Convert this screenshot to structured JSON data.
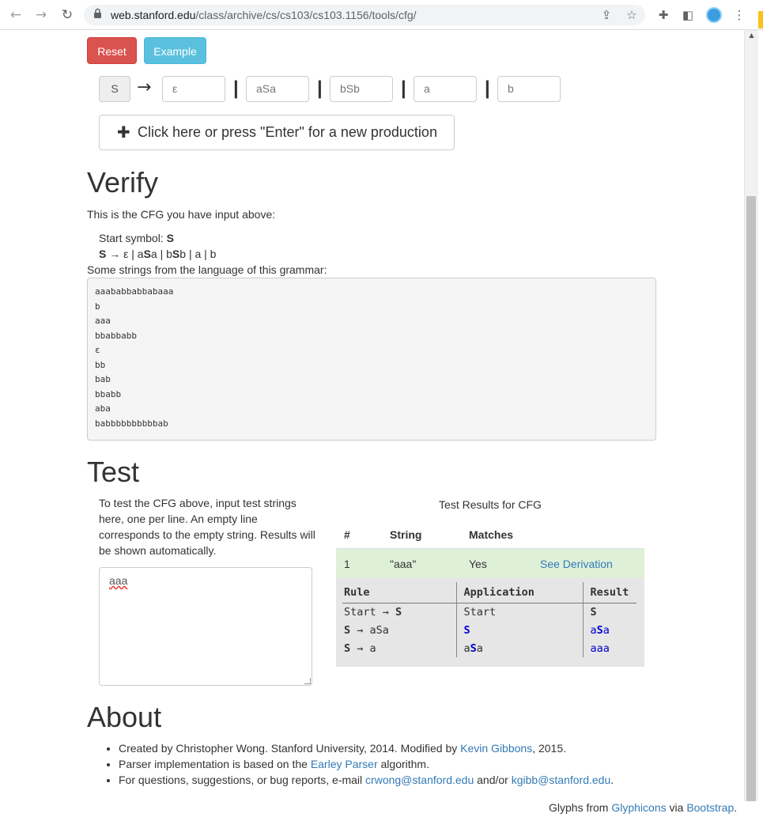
{
  "browser": {
    "url_host": "web.stanford.edu",
    "url_path": "/class/archive/cs/cs103/cs103.1156/tools/cfg/"
  },
  "toolbar": {
    "reset_label": "Reset",
    "example_label": "Example"
  },
  "production": {
    "start": "S",
    "arrow": "→",
    "separator": "|",
    "alternatives": [
      "ε",
      "aSa",
      "bSb",
      "a",
      "b"
    ]
  },
  "new_production_label": "Click here or press \"Enter\" for a new production",
  "verify": {
    "heading": "Verify",
    "intro": "This is the CFG you have input above:",
    "start_label": "Start symbol: ",
    "start_value": "S",
    "rule_lhs": "S",
    "rule_arrow": " → ε | a",
    "rule_s1": "S",
    "rule_mid": "a | b",
    "rule_s2": "S",
    "rule_tail": "b | a | b",
    "strings_label": "Some strings from the language of this grammar:",
    "strings": [
      "aaababbabbabaaa",
      "b",
      "aaa",
      "bbabbabb",
      "ε",
      "bb",
      "bab",
      "bbabb",
      "aba",
      "babbbbbbbbbbab"
    ]
  },
  "test": {
    "heading": "Test",
    "help": "To test the CFG above, input test strings here, one per line. An empty line corresponds to the empty string. Results will be shown automatically.",
    "input_value": "aaa",
    "results_caption": "Test Results for CFG",
    "columns": [
      "#",
      "String",
      "Matches"
    ],
    "row": {
      "num": "1",
      "string": "\"aaa\"",
      "matches": "Yes",
      "link": "See Derivation"
    },
    "derivation": {
      "headers": [
        "Rule",
        "Application",
        "Result"
      ],
      "rows": [
        {
          "rule_a": "Start → ",
          "rule_b": "S",
          "app": "Start",
          "res": "S"
        },
        {
          "rule_a": "S",
          "rule_b": " → aSa",
          "app": "S",
          "res_a": "a",
          "res_s": "S",
          "res_b": "a"
        },
        {
          "rule_a": "S",
          "rule_b": " → a",
          "app_a": "a",
          "app_s": "S",
          "app_b": "a",
          "res": "aaa"
        }
      ]
    }
  },
  "about": {
    "heading": "About",
    "items": [
      {
        "pre": "Created by Christopher Wong. Stanford University, 2014. Modified by ",
        "link": "Kevin Gibbons",
        "post": ", 2015."
      },
      {
        "pre": "Parser implementation is based on the ",
        "link": "Earley Parser",
        "post": " algorithm."
      },
      {
        "pre": "For questions, suggestions, or bug reports, e-mail ",
        "link": "crwong@stanford.edu",
        "mid": " and/or ",
        "link2": "kgibb@stanford.edu",
        "post": "."
      }
    ]
  },
  "footer": {
    "pre": "Glyphs from ",
    "link1": "Glyphicons",
    "mid": " via ",
    "link2": "Bootstrap",
    "post": "."
  }
}
